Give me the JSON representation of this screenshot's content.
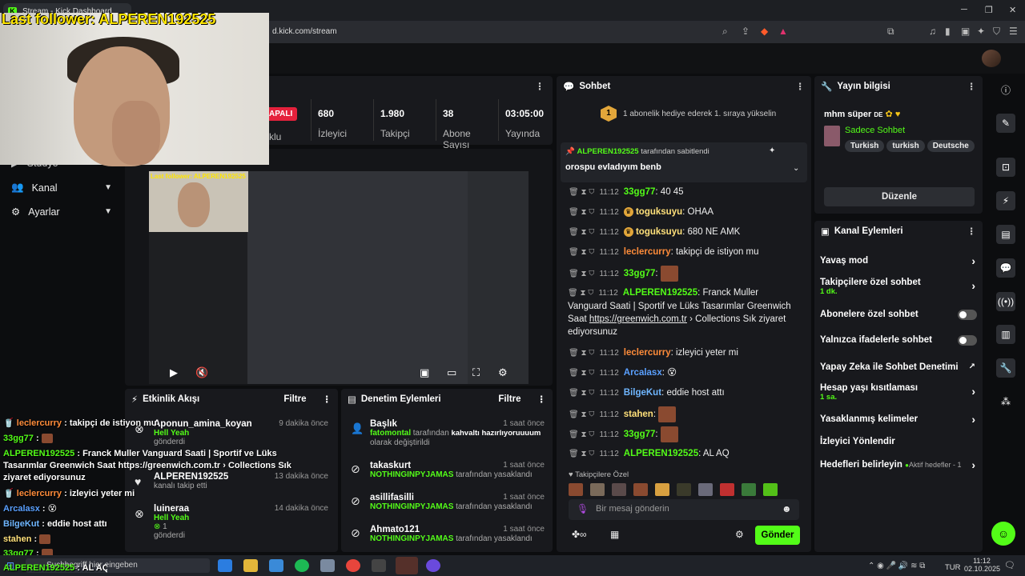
{
  "browser": {
    "tab_title": "Stream - Kick Dashboard",
    "url": "d.kick.com/stream"
  },
  "overlay": {
    "follower_text": "Last follower: ALPEREN192525",
    "mini_follower": "Last follower: ALPEREN192525"
  },
  "status": {
    "live_label": "APALI",
    "partial_label": "klu"
  },
  "stats": [
    {
      "value": "680",
      "label": "İzleyici"
    },
    {
      "value": "1.980",
      "label": "Takipçi"
    },
    {
      "value": "38",
      "label": "Abone Sayısı"
    },
    {
      "value": "03:05:00",
      "label": "Yayında Olduğu"
    }
  ],
  "nav": {
    "studio": "Stüdyo",
    "channel": "Kanal",
    "settings": "Ayarlar"
  },
  "activity": {
    "title": "Etkinlik Akışı",
    "filter": "Filtre",
    "items": [
      {
        "name": "Aponun_amina_koyan",
        "time": "9 dakika önce",
        "line1": "Hell Yeah",
        "line2": "gönderdi"
      },
      {
        "name": "ALPEREN192525",
        "time": "13 dakika önce",
        "line1": "kanalı takip etti",
        "line2": ""
      },
      {
        "name": "luineraa",
        "time": "14 dakika önce",
        "line1": "Hell Yeah",
        "count": "1",
        "line2": "gönderdi"
      }
    ]
  },
  "moderation": {
    "title": "Denetim Eylemleri",
    "filter": "Filtre",
    "items": [
      {
        "name": "Başlık",
        "time": "1 saat önce",
        "actor": "fatomontal",
        "text": "tarafından",
        "text2": "kahvaltı hazırlıyoruuuum",
        "text3": "olarak değiştirildi"
      },
      {
        "name": "takaskurt",
        "time": "1 saat önce",
        "actor": "NOTHINGINPYJAMAS",
        "text": "tarafından yasaklandı"
      },
      {
        "name": "asillifasilli",
        "time": "1 saat önce",
        "actor": "NOTHINGINPYJAMAS",
        "text": "tarafından yasaklandı"
      },
      {
        "name": "Ahmato121",
        "time": "1 saat önce",
        "actor": "NOTHINGINPYJAMAS",
        "text": "tarafından yasaklandı"
      }
    ]
  },
  "chat": {
    "title": "Sohbet",
    "goal_badge": "1",
    "goal_text": "1 abonelik hediye ederek 1. sıraya yükselin",
    "pinned_by": "ALPEREN192525",
    "pinned_suffix": "tarafından sabitlendi",
    "pinned_msg": "orospu evladıyım benb",
    "time": "11:12",
    "messages": [
      {
        "user": "33gg77",
        "text": "40 45"
      },
      {
        "user": "toguksuyu",
        "text": "OHAA"
      },
      {
        "user": "toguksuyu",
        "text": "680 NE AMK"
      },
      {
        "user": "leclercurry",
        "text": "takipçi de istiyon mu"
      },
      {
        "user": "33gg77",
        "text": ""
      },
      {
        "user": "ALPEREN192525",
        "text": "Franck Muller Vanguard Saati | Sportif ve Lüks Tasarımlar Greenwich Saat",
        "link": "https://greenwich.com.tr",
        "text2": "› Collections Sık ziyaret ediyorsunuz"
      },
      {
        "user": "leclercurry",
        "text": "izleyici yeter mi"
      },
      {
        "user": "Arcalasx",
        "text": ""
      },
      {
        "user": "BilgeKut",
        "text": "eddie host attı"
      },
      {
        "user": "stahen",
        "text": ""
      },
      {
        "user": "33gg77",
        "text": ""
      },
      {
        "user": "ALPEREN192525",
        "text": "AL AQ"
      }
    ],
    "emote_label": "Takipçilere Özel",
    "input_placeholder": "Bir mesaj gönderin",
    "send": "Gönder"
  },
  "stream_info": {
    "title": "Yayın bilgisi",
    "stream_title": "mhm süper",
    "lang_mark": "DE",
    "category": "Sadece Sohbet",
    "tags": [
      "Turkish",
      "turkish",
      "Deutsche"
    ],
    "edit": "Düzenle"
  },
  "channel_actions": {
    "title": "Kanal Eylemleri",
    "items": [
      {
        "label": "Yavaş mod",
        "type": "arrow"
      },
      {
        "label": "Takipçilere özel sohbet",
        "sub": "1 dk.",
        "type": "arrow"
      },
      {
        "label": "Abonelere özel sohbet",
        "type": "toggle"
      },
      {
        "label": "Yalnızca ifadelerle sohbet",
        "type": "toggle"
      },
      {
        "label": "Yapay Zeka ile Sohbet Denetimi",
        "type": "ext"
      },
      {
        "label": "Hesap yaşı kısıtlaması",
        "sub": "1 sa.",
        "type": "arrow"
      },
      {
        "label": "Yasaklanmış kelimeler",
        "type": "arrow"
      },
      {
        "label": "İzleyici Yönlendir",
        "type": "none"
      },
      {
        "label": "Hedefleri belirleyin",
        "badge": "Aktif hedefler - 1",
        "type": "arrow"
      }
    ]
  },
  "overlay_chat": [
    {
      "user": "leclercurry",
      "text": "takipçi de istiyon mu"
    },
    {
      "user": "33gg77",
      "text": ""
    },
    {
      "user": "ALPEREN192525",
      "text": "Franck Muller Vanguard Saati | Sportif ve Lüks Tasarımlar Greenwich Saat https://greenwich.com.tr › Collections Sık ziyaret ediyorsunuz"
    },
    {
      "user": "leclercurry",
      "text": "izleyici yeter mi"
    },
    {
      "user": "Arcalasx",
      "text": ""
    },
    {
      "user": "BilgeKut",
      "text": "eddie host attı"
    },
    {
      "user": "stahen",
      "text": ""
    },
    {
      "user": "33gg77",
      "text": ""
    },
    {
      "user": "ALPEREN192525",
      "text": "AL AQ"
    }
  ],
  "taskbar": {
    "search": "Suchbegriff hier eingeben",
    "lang": "TUR",
    "time": "11:12",
    "date": "02.10.2025"
  },
  "colors": {
    "kick_green": "#53fc18",
    "panel": "#18191d",
    "bg": "#0c0d0f"
  }
}
